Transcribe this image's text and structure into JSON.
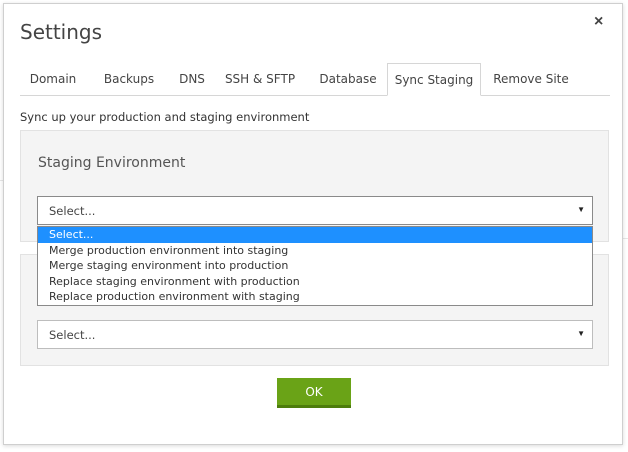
{
  "dialog": {
    "title": "Settings",
    "close_label": "×"
  },
  "tabs": [
    {
      "label": "Domain",
      "active": false
    },
    {
      "label": "Backups",
      "active": false
    },
    {
      "label": "DNS",
      "active": false
    },
    {
      "label": "SSH & SFTP",
      "active": false
    },
    {
      "label": "Database",
      "active": false
    },
    {
      "label": "Sync Staging",
      "active": true
    },
    {
      "label": "Remove Site",
      "active": false
    }
  ],
  "content": {
    "description": "Sync up your production and staging environment",
    "staging_panel": {
      "title": "Staging Environment",
      "select": {
        "value": "Select...",
        "expanded": true,
        "options": [
          "Select...",
          "Merge production environment into staging",
          "Merge staging environment into production",
          "Replace staging environment with production",
          "Replace production environment with staging"
        ],
        "selected_index": 0
      }
    },
    "second_panel": {
      "select": {
        "value": "Select..."
      }
    }
  },
  "footer": {
    "ok_label": "OK"
  },
  "icons": {
    "close": "close-icon",
    "caret": "caret-down-icon"
  },
  "colors": {
    "ok_button": "#6aa317",
    "selected_option": "#1e90ff",
    "panel_background": "#f4f4f4"
  }
}
